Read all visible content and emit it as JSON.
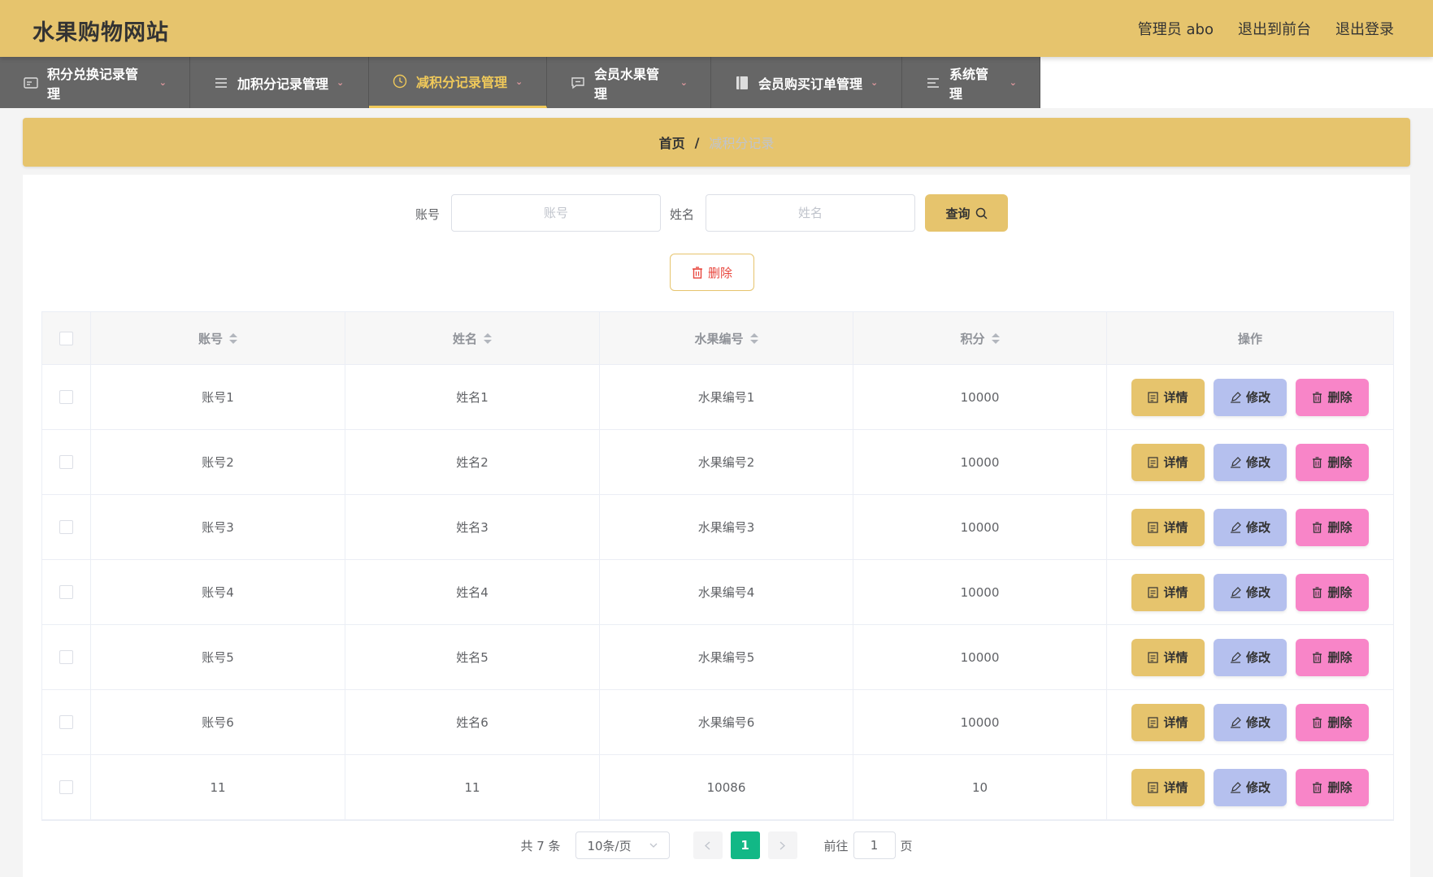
{
  "header": {
    "site_title": "水果购物网站",
    "admin_label": "管理员 abo",
    "front_link": "退出到前台",
    "logout_link": "退出登录"
  },
  "nav": {
    "items": [
      {
        "label": "积分兑换记录管理",
        "icon": "card-icon"
      },
      {
        "label": "加积分记录管理",
        "icon": "list-icon"
      },
      {
        "label": "减积分记录管理",
        "icon": "clock-icon",
        "active": true
      },
      {
        "label": "会员水果管理",
        "icon": "chat-icon"
      },
      {
        "label": "会员购买订单管理",
        "icon": "book-icon"
      },
      {
        "label": "系统管理",
        "icon": "menu-icon"
      }
    ]
  },
  "breadcrumb": {
    "home": "首页",
    "sep": "/",
    "current": "减积分记录"
  },
  "search": {
    "account_label": "账号",
    "account_placeholder": "账号",
    "account_value": "",
    "name_label": "姓名",
    "name_placeholder": "姓名",
    "name_value": "",
    "query_button": "查询",
    "delete_button": "删除"
  },
  "table": {
    "columns": [
      "账号",
      "姓名",
      "水果编号",
      "积分",
      "操作"
    ],
    "rows": [
      {
        "account": "账号1",
        "name": "姓名1",
        "fruit_no": "水果编号1",
        "points": "10000"
      },
      {
        "account": "账号2",
        "name": "姓名2",
        "fruit_no": "水果编号2",
        "points": "10000"
      },
      {
        "account": "账号3",
        "name": "姓名3",
        "fruit_no": "水果编号3",
        "points": "10000"
      },
      {
        "account": "账号4",
        "name": "姓名4",
        "fruit_no": "水果编号4",
        "points": "10000"
      },
      {
        "account": "账号5",
        "name": "姓名5",
        "fruit_no": "水果编号5",
        "points": "10000"
      },
      {
        "account": "账号6",
        "name": "姓名6",
        "fruit_no": "水果编号6",
        "points": "10000"
      },
      {
        "account": "11",
        "name": "11",
        "fruit_no": "10086",
        "points": "10"
      }
    ],
    "actions": {
      "detail": "详情",
      "edit": "修改",
      "delete": "删除"
    }
  },
  "pagination": {
    "total": "共 7 条",
    "page_size": "10条/页",
    "current_page": "1",
    "goto_label": "前往",
    "goto_value": "1",
    "page_suffix": "页"
  },
  "colors": {
    "accent": "#e6c46d",
    "nav_bg": "#666666",
    "active_nav": "#f0c95a",
    "edit_btn": "#b5c0ee",
    "delete_btn": "#f885c8",
    "pager_active": "#12b886"
  }
}
